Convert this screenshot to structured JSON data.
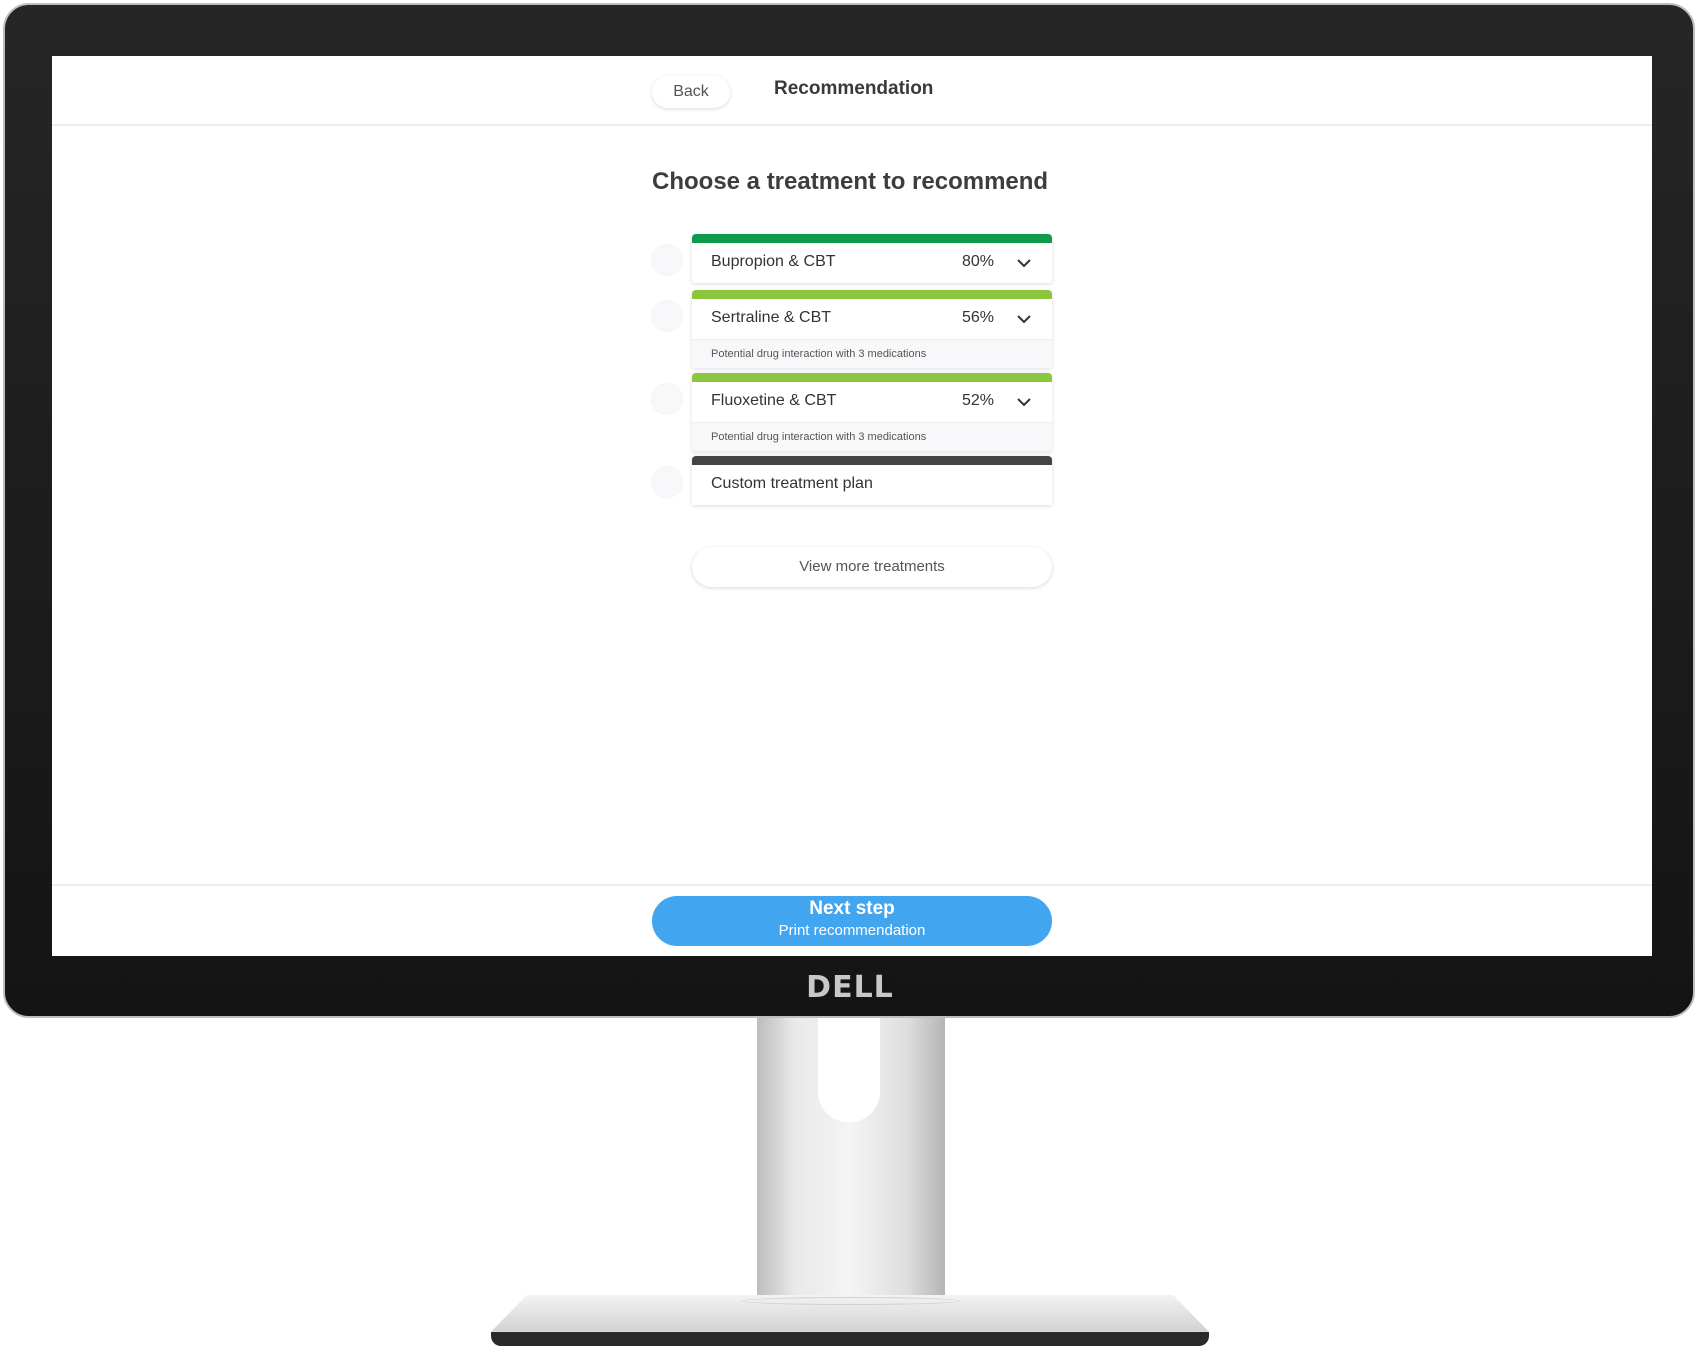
{
  "monitor": {
    "brand": "DELL"
  },
  "header": {
    "back_label": "Back",
    "title": "Recommendation"
  },
  "main": {
    "title": "Choose a treatment to recommend",
    "treatments": [
      {
        "name": "Bupropion & CBT",
        "percent": "80%",
        "bar_color": "#0e9a4a",
        "note": ""
      },
      {
        "name": "Sertraline & CBT",
        "percent": "56%",
        "bar_color": "#8cc63f",
        "note": "Potential drug interaction with 3 medications"
      },
      {
        "name": "Fluoxetine & CBT",
        "percent": "52%",
        "bar_color": "#8cc63f",
        "note": "Potential drug interaction with 3 medications"
      },
      {
        "name": "Custom treatment plan",
        "percent": "",
        "bar_color": "#444444",
        "note": ""
      }
    ],
    "view_more_label": "View more treatments"
  },
  "footer": {
    "next_label": "Next step",
    "next_sublabel": "Print recommendation",
    "accent": "#42a5f0"
  }
}
